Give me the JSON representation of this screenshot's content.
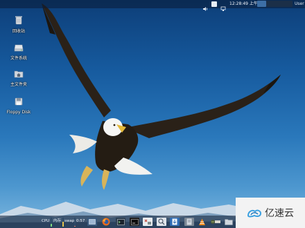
{
  "top_panel": {
    "clock": "12:28:49 上午",
    "user": "User"
  },
  "desktop": {
    "icons": [
      {
        "label": "回收站",
        "icon": "trash-icon"
      },
      {
        "label": "文件系统",
        "icon": "drive-icon"
      },
      {
        "label": "主文件夹",
        "icon": "home-folder-icon"
      },
      {
        "label": "Floppy Disk",
        "icon": "floppy-icon"
      }
    ]
  },
  "bottom_panel": {
    "cpu_label": "CPU",
    "mem_label": "内存",
    "swap_label": "swap",
    "clock": "0:57",
    "cpu_usage": 0.3,
    "mem_usage": 0.55,
    "swap_usage": 0.1,
    "launchers": [
      "show-desktop-icon",
      "firefox-icon",
      "terminal-icon",
      "terminal-dark-icon",
      "settings-icon",
      "search-icon",
      "text-editor-icon",
      "download-icon",
      "vlc-icon",
      "network-icon",
      "folder-icon"
    ]
  },
  "watermark": {
    "brand": "亿速云"
  },
  "colors": {
    "sky_top": "#0d3e78",
    "sky_bottom": "#7fb8df",
    "panel": "#0e1e34",
    "accent": "#3d6fa6"
  }
}
